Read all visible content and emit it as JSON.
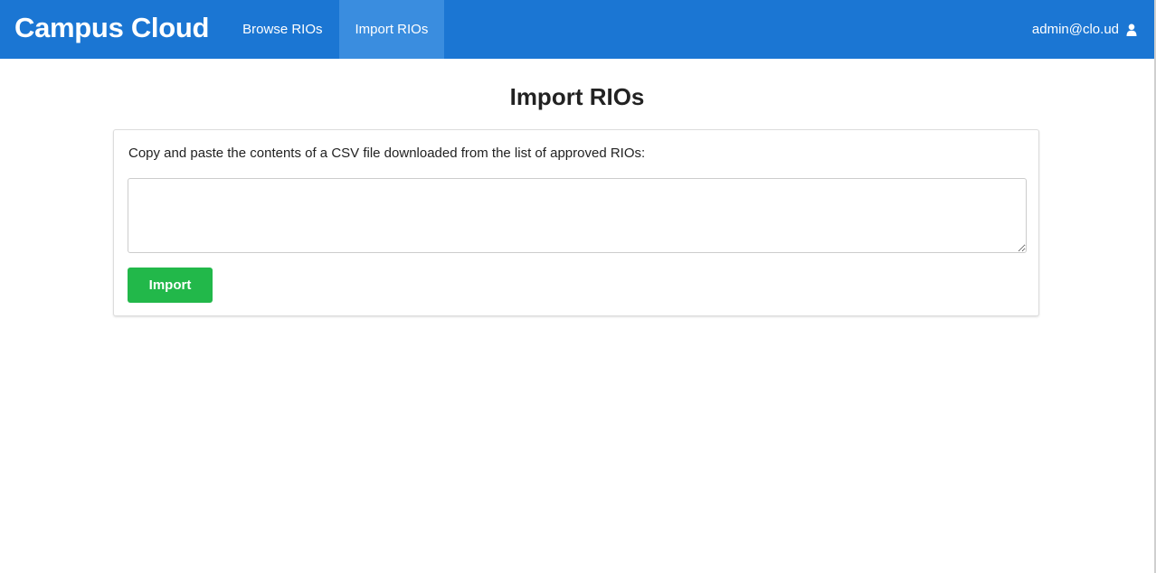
{
  "navbar": {
    "brand": "Campus Cloud",
    "links": [
      {
        "label": "Browse RIOs",
        "active": false
      },
      {
        "label": "Import RIOs",
        "active": true
      }
    ],
    "user": {
      "email": "admin@clo.ud",
      "icon": "user-icon"
    },
    "color": "#1b76d3",
    "active_color": "#3a8ddf"
  },
  "main": {
    "title": "Import RIOs",
    "instructions": "Copy and paste the contents of a CSV file downloaded from the list of approved RIOs:",
    "csv_input": {
      "value": "",
      "placeholder": ""
    },
    "import_button": {
      "label": "Import",
      "color": "#22b84a"
    }
  }
}
